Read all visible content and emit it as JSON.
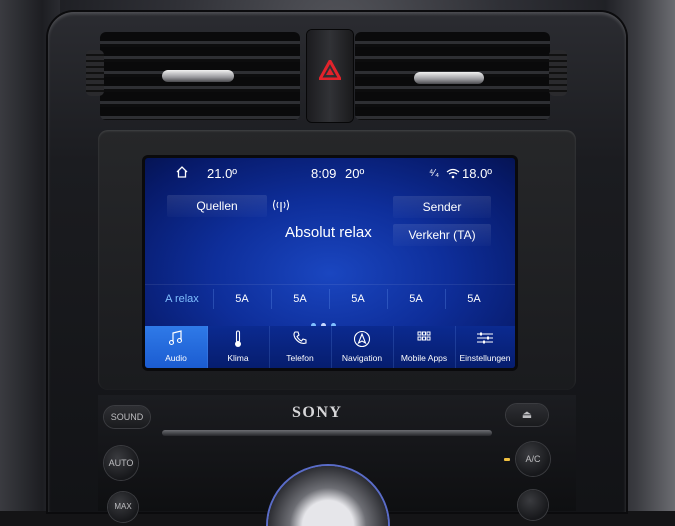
{
  "status_bar": {
    "temp_left": "21.0º",
    "time": "8:09",
    "outside_temp": "20º",
    "network": "⁴⁄₄",
    "temp_right": "18.0º"
  },
  "radio": {
    "sources_label": "Quellen",
    "station_name": "Absolut relax",
    "sender_label": "Sender",
    "traffic_label": "Verkehr (TA)"
  },
  "presets": [
    "A relax",
    "5A",
    "5A",
    "5A",
    "5A",
    "5A"
  ],
  "nav": [
    {
      "label": "Audio",
      "icon": "music-note-icon",
      "active": true
    },
    {
      "label": "Klima",
      "icon": "thermometer-icon",
      "active": false
    },
    {
      "label": "Telefon",
      "icon": "phone-icon",
      "active": false
    },
    {
      "label": "Navigation",
      "icon": "navigation-icon",
      "active": false
    },
    {
      "label": "Mobile Apps",
      "icon": "apps-grid-icon",
      "active": false
    },
    {
      "label": "Einstellungen",
      "icon": "settings-sliders-icon",
      "active": false
    }
  ],
  "console": {
    "brand": "SONY",
    "sound_label": "SOUND",
    "eject_label": "⏏",
    "auto_label": "AUTO",
    "ac_label": "A/C",
    "max_label": "MAX"
  },
  "colors": {
    "screen_blue": "#0e2e9a",
    "active_tab": "#2f7ae8",
    "accent_text": "#7fbfff",
    "hazard_red": "#e2232b"
  }
}
